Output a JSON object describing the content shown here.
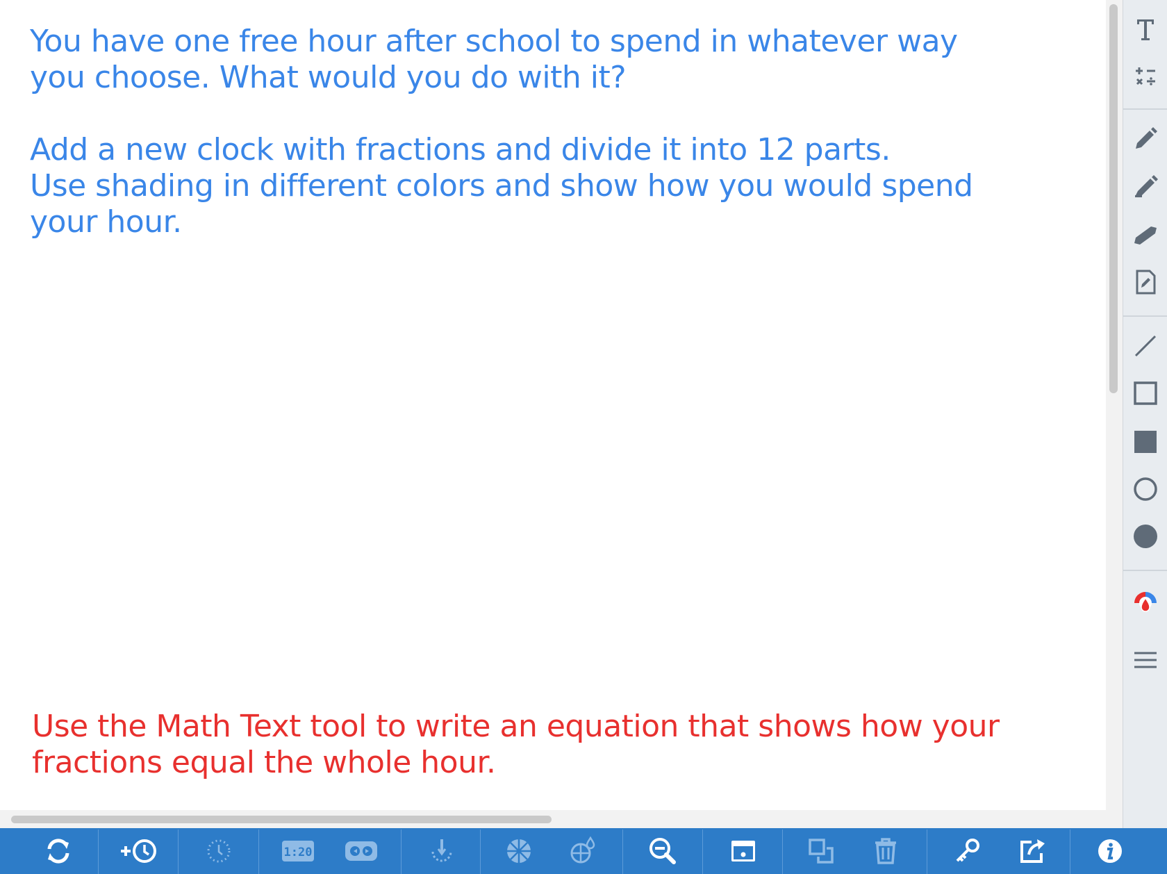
{
  "prompt": {
    "line1": "You have one free hour after school to spend in whatever way",
    "line2": "you choose. What would you do with it?",
    "line3": "Add a new clock with fractions and divide it into 12 parts.",
    "line4": "Use shading in different colors and show how you would spend",
    "line5": "your hour."
  },
  "footer_note": {
    "line1": "Use the Math Text tool to write an equation that shows how your",
    "line2": "fractions equal the whole hour."
  },
  "clock_digits": "1:20",
  "colors": {
    "prompt_text": "#3a86e8",
    "note_text": "#e8302e",
    "toolbar_blue": "#2d7cc8",
    "sidebar_bg": "#e8ecf0",
    "tool_icon": "#5f6b78"
  },
  "sidebar_tools": [
    "text-icon",
    "math-text-icon",
    "pencil-icon",
    "marker-icon",
    "highlighter-icon",
    "note-icon",
    "line-icon",
    "rectangle-icon",
    "filled-rectangle-icon",
    "circle-icon",
    "filled-circle-icon",
    "color-picker-icon",
    "line-weight-icon"
  ],
  "bottom_tools": [
    "refresh-icon",
    "add-clock-icon",
    "dotted-clock-icon",
    "digital-clock-icon",
    "toggle-icon",
    "snap-icon",
    "fraction-wheel-icon",
    "fraction-color-icon",
    "zoom-out-icon",
    "image-icon",
    "duplicate-icon",
    "trash-icon",
    "key-icon",
    "share-icon",
    "info-icon"
  ]
}
